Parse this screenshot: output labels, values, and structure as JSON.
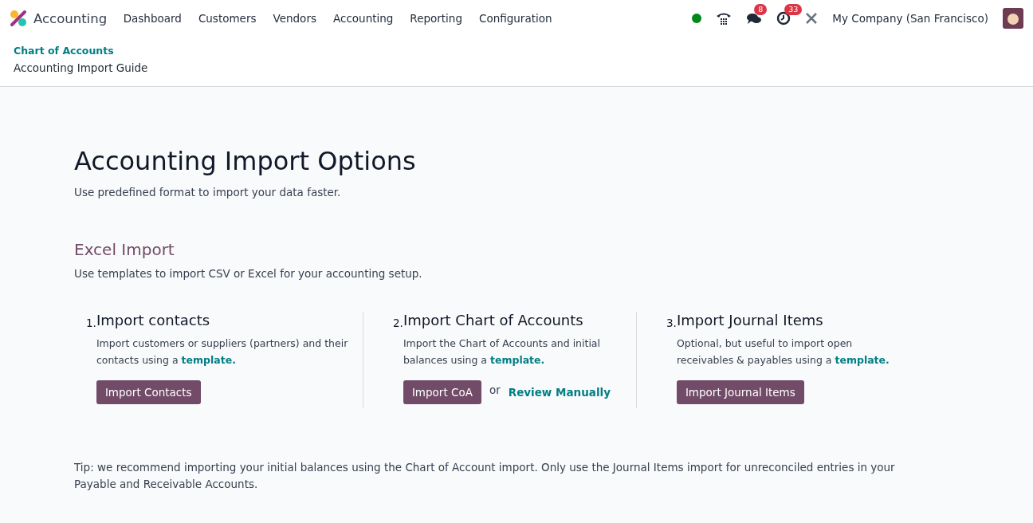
{
  "navbar": {
    "app_name": "Accounting",
    "menu": [
      {
        "label": "Dashboard"
      },
      {
        "label": "Customers"
      },
      {
        "label": "Vendors"
      },
      {
        "label": "Accounting"
      },
      {
        "label": "Reporting"
      },
      {
        "label": "Configuration"
      }
    ],
    "status_online": true,
    "messages_badge": "8",
    "activities_badge": "33",
    "company": "My Company (San Francisco)"
  },
  "breadcrumb": {
    "parent": "Chart of Accounts",
    "current": "Accounting Import Guide"
  },
  "page": {
    "title": "Accounting Import Options",
    "subtitle": "Use predefined format to import your data faster.",
    "section_title": "Excel Import",
    "section_subtitle": "Use templates to import CSV or Excel for your accounting setup.",
    "steps": [
      {
        "number": "1.",
        "title": "Import contacts",
        "description": "Import customers or suppliers (partners) and their contacts using a ",
        "link": "template.",
        "actions": [
          {
            "kind": "button",
            "label": "Import Contacts"
          }
        ]
      },
      {
        "number": "2.",
        "title": "Import Chart of Accounts",
        "description": "Import the Chart of Accounts and initial balances using a ",
        "link": "template.",
        "actions": [
          {
            "kind": "button",
            "label": "Import CoA"
          },
          {
            "kind": "or",
            "label": "or"
          },
          {
            "kind": "link",
            "label": "Review Manually"
          }
        ]
      },
      {
        "number": "3.",
        "title": "Import Journal Items",
        "description": "Optional, but useful to import open receivables & payables using a ",
        "link": "template.",
        "actions": [
          {
            "kind": "button",
            "label": "Import Journal Items"
          }
        ]
      }
    ],
    "tip": "Tip: we recommend importing your initial balances using the Chart of Account import. Only use the Journal Items import for unreconciled entries in your Payable and Receivable Accounts."
  }
}
